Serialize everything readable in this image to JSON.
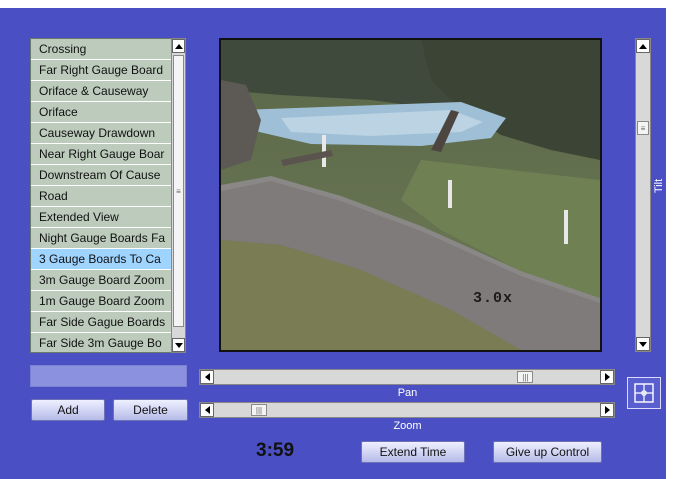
{
  "presets": {
    "items": [
      {
        "label": "Crossing",
        "selected": false
      },
      {
        "label": "Far Right Gauge Board",
        "selected": false
      },
      {
        "label": "Oriface & Causeway",
        "selected": false
      },
      {
        "label": "Oriface",
        "selected": false
      },
      {
        "label": "Causeway Drawdown",
        "selected": false
      },
      {
        "label": "Near Right Gauge Boar",
        "selected": false
      },
      {
        "label": "Downstream Of Cause",
        "selected": false
      },
      {
        "label": "Road",
        "selected": false
      },
      {
        "label": "Extended View",
        "selected": false
      },
      {
        "label": "Night Gauge Boards Fa",
        "selected": false
      },
      {
        "label": "3 Gauge Boards To Ca",
        "selected": true
      },
      {
        "label": "3m Gauge Board Zoom",
        "selected": false
      },
      {
        "label": "1m Gauge Board Zoom",
        "selected": false
      },
      {
        "label": "Far Side Gague Boards",
        "selected": false
      },
      {
        "label": "Far Side 3m Gauge Bo",
        "selected": false
      }
    ],
    "scroll_position": 0.45
  },
  "video": {
    "zoom_overlay": "3.0x"
  },
  "tilt": {
    "label": "Tilt",
    "position": 0.25
  },
  "pan": {
    "label": "Pan",
    "position": 0.82
  },
  "zoom": {
    "label": "Zoom",
    "position": 0.1
  },
  "buttons": {
    "add": "Add",
    "delete": "Delete",
    "extend_time": "Extend Time",
    "give_up_control": "Give up Control"
  },
  "timer": "3:59",
  "colors": {
    "background": "#4a4fc3",
    "selected_item": "#9fd4ff",
    "list_item": "#bccbbc"
  },
  "icons": {
    "center": "crosshair-icon"
  }
}
